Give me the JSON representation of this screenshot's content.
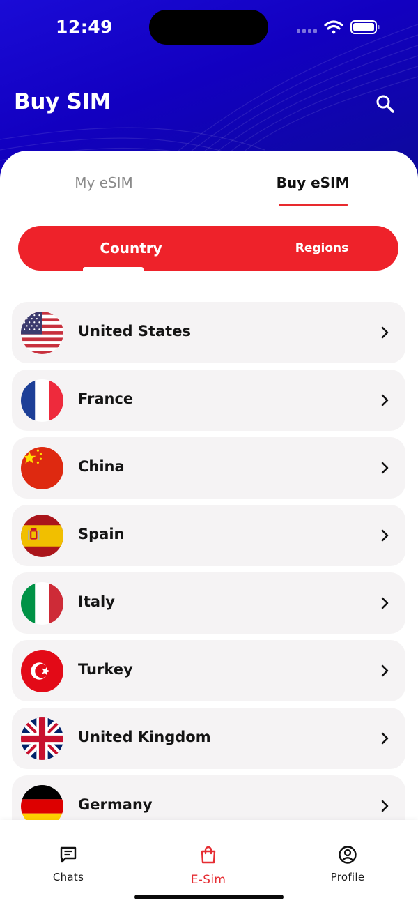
{
  "status_bar": {
    "time": "12:49"
  },
  "header": {
    "title": "Buy SIM"
  },
  "tabs": {
    "my_esim": "My eSIM",
    "buy_esim": "Buy eSIM"
  },
  "segment": {
    "country": "Country",
    "regions": "Regions"
  },
  "countries": [
    {
      "name": "United States",
      "flag": "us-flag-icon"
    },
    {
      "name": "France",
      "flag": "france-flag-icon"
    },
    {
      "name": "China",
      "flag": "china-flag-icon"
    },
    {
      "name": "Spain",
      "flag": "spain-flag-icon"
    },
    {
      "name": "Italy",
      "flag": "italy-flag-icon"
    },
    {
      "name": "Turkey",
      "flag": "turkey-flag-icon"
    },
    {
      "name": "United Kingdom",
      "flag": "uk-flag-icon"
    },
    {
      "name": "Germany",
      "flag": "germany-flag-icon"
    }
  ],
  "bottom_nav": {
    "chats": "Chats",
    "esim": "E-Sim",
    "profile": "Profile"
  },
  "colors": {
    "header_blue": "#1200c0",
    "accent_red": "#ee222a",
    "row_bg": "#f5f3f4"
  }
}
